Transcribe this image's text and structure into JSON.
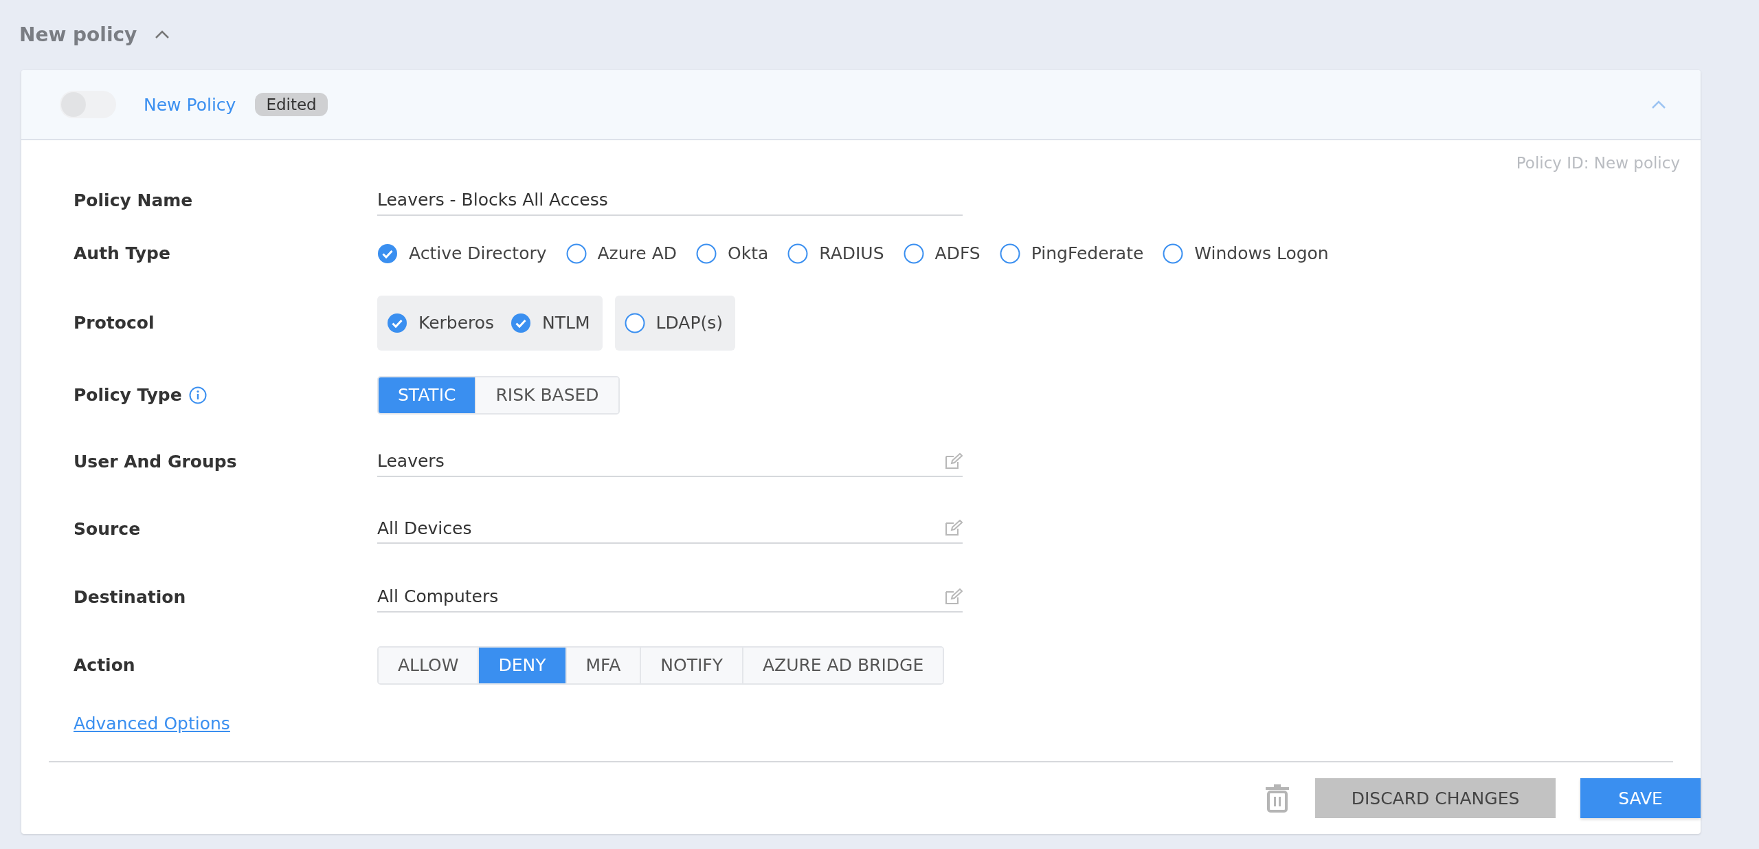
{
  "section": {
    "title": "New policy",
    "expanded": true
  },
  "policy": {
    "enabled": false,
    "name": "New Policy",
    "badge": "Edited",
    "expanded": true,
    "policy_id": "Policy ID: New policy"
  },
  "fields": [
    {
      "kind": "text",
      "label": "Policy Name",
      "value": "Leavers - Blocks All Access"
    },
    {
      "kind": "choices",
      "label": "Auth Type",
      "options": [
        {
          "label": "Active Directory",
          "checked": true
        },
        {
          "label": "Azure AD",
          "checked": false
        },
        {
          "label": "Okta",
          "checked": false
        },
        {
          "label": "RADIUS",
          "checked": false
        },
        {
          "label": "ADFS",
          "checked": false
        },
        {
          "label": "PingFederate",
          "checked": false
        },
        {
          "label": "Windows Logon",
          "checked": false
        }
      ]
    },
    {
      "kind": "groups",
      "label": "Protocol",
      "groups": [
        [
          {
            "label": "Kerberos",
            "checked": true
          },
          {
            "label": "NTLM",
            "checked": true
          }
        ],
        [
          {
            "label": "LDAP(s)",
            "checked": false
          }
        ]
      ]
    },
    {
      "kind": "segmented",
      "label": "Policy Type",
      "info": true,
      "options": [
        {
          "label": "STATIC",
          "selected": true
        },
        {
          "label": "RISK BASED",
          "selected": false
        }
      ]
    },
    {
      "kind": "picker",
      "label": "User And Groups",
      "value": "Leavers"
    },
    {
      "kind": "picker",
      "label": "Source",
      "value": "All Devices"
    },
    {
      "kind": "picker",
      "label": "Destination",
      "value": "All Computers"
    },
    {
      "kind": "segmented",
      "label": "Action",
      "info": false,
      "options": [
        {
          "label": "ALLOW",
          "selected": false
        },
        {
          "label": "DENY",
          "selected": true
        },
        {
          "label": "MFA",
          "selected": false
        },
        {
          "label": "NOTIFY",
          "selected": false
        },
        {
          "label": "AZURE AD BRIDGE",
          "selected": false
        }
      ]
    }
  ],
  "advanced_link": "Advanced Options",
  "footer": {
    "discard": "DISCARD CHANGES",
    "save": "SAVE"
  }
}
